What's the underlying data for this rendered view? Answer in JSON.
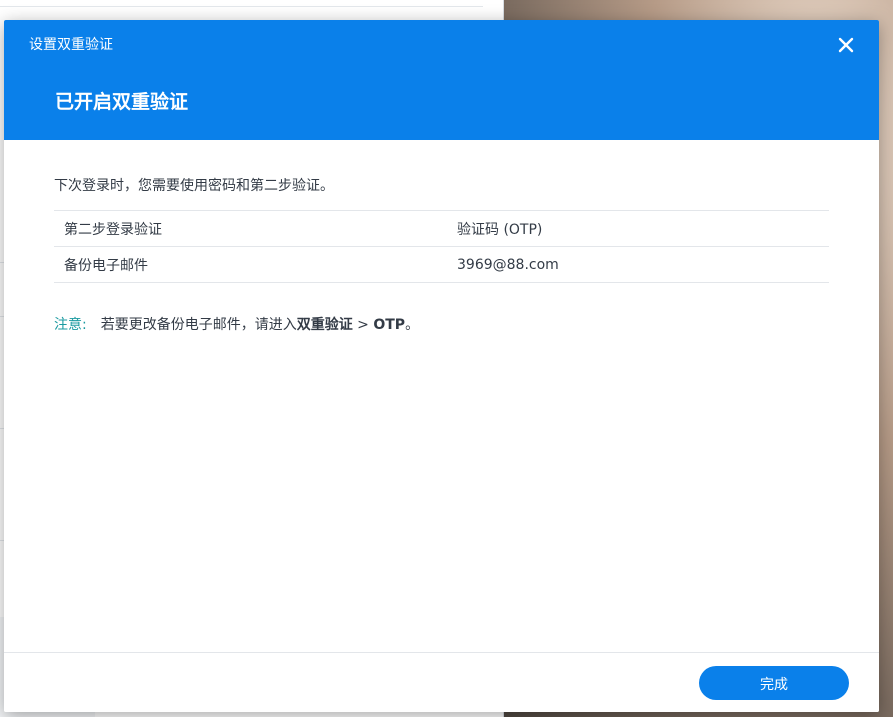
{
  "dialog": {
    "title": "设置双重验证",
    "heading": "已开启双重验证",
    "intro": "下次登录时，您需要使用密码和第二步验证。",
    "rows": [
      {
        "label": "第二步登录验证",
        "value": "验证码 (OTP)"
      },
      {
        "label": "备份电子邮件",
        "value": "3969@88.com"
      }
    ],
    "note": {
      "label": "注意:",
      "text_before": "若要更改备份电子邮件，请进入",
      "bold_path_1": "双重验证",
      "separator": " > ",
      "bold_path_2": "OTP",
      "text_after": "。"
    },
    "done_label": "完成"
  },
  "colors": {
    "accent": "#0a80ea",
    "note_label": "#1a9aa0",
    "text": "#333b46"
  },
  "icons": {
    "close": "close-icon"
  }
}
